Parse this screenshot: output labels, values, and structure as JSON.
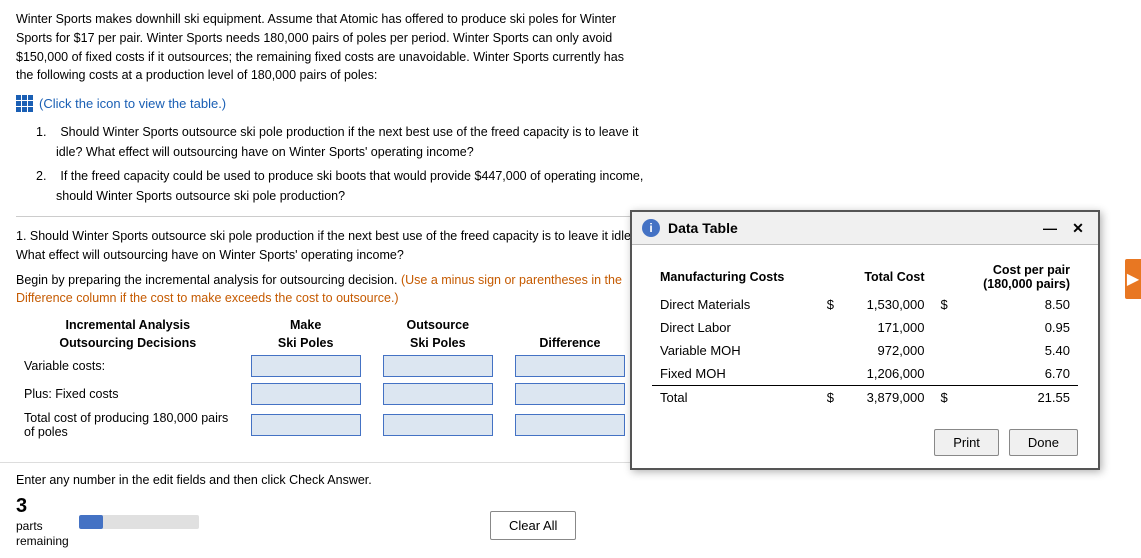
{
  "problem": {
    "text": "Winter Sports makes downhill ski equipment. Assume that Atomic has offered to produce ski poles for Winter Sports for $17 per pair. Winter Sports needs 180,000 pairs of poles per period. Winter Sports can only avoid $150,000 of fixed costs if it outsources; the remaining fixed costs are unavoidable. Winter Sports currently has the following costs at a production level of 180,000 pairs of poles:",
    "click_icon_text": "(Click the icon to view the table.)"
  },
  "questions": [
    {
      "number": "1.",
      "text": "Should Winter Sports outsource ski pole production if the next best use of the freed capacity is to leave it idle? What effect will outsourcing have on Winter Sports' operating income?"
    },
    {
      "number": "2.",
      "text": "If the freed capacity could be used to produce ski boots that would provide $447,000 of operating income, should Winter Sports outsource ski pole production?"
    }
  ],
  "question1_heading": "1. Should Winter Sports outsource ski pole production if the next best use of the freed capacity is to leave it idle? What effect will outsourcing have on Winter Sports' operating income?",
  "begin_text": "Begin by preparing the incremental analysis for outsourcing decision.",
  "orange_note": "(Use a minus sign or parentheses in the Difference column if the cost to make exceeds the cost to outsource.)",
  "table": {
    "col1": "Incremental Analysis",
    "col2_top": "Make",
    "col3_top": "Outsource",
    "col1_sub": "Outsourcing Decisions",
    "col2_sub": "Ski Poles",
    "col3_sub": "Ski Poles",
    "col4_sub": "Difference",
    "rows": [
      {
        "label": "Variable costs:",
        "make": "",
        "outsource": "",
        "diff": ""
      },
      {
        "label": "Plus: Fixed costs",
        "make": "",
        "outsource": "",
        "diff": ""
      },
      {
        "label": "Total cost of producing 180,000 pairs of poles",
        "make": "",
        "outsource": "",
        "diff": ""
      }
    ]
  },
  "bottom": {
    "enter_text": "Enter any number in the edit fields and then click Check Answer.",
    "parts_number": "3",
    "parts_label": "parts",
    "parts_sub": "remaining",
    "clear_all": "Clear All",
    "progress_pct": 20
  },
  "data_table_popup": {
    "title": "Data Table",
    "headers": {
      "col1": "Manufacturing Costs",
      "col2": "Total Cost",
      "col3_top": "Cost per pair",
      "col3_bot": "(180,000 pairs)"
    },
    "rows": [
      {
        "name": "Direct Materials",
        "dollar1": "$",
        "total": "1,530,000",
        "dollar2": "$",
        "per_pair": "8.50"
      },
      {
        "name": "Direct Labor",
        "dollar1": "",
        "total": "171,000",
        "dollar2": "",
        "per_pair": "0.95"
      },
      {
        "name": "Variable MOH",
        "dollar1": "",
        "total": "972,000",
        "dollar2": "",
        "per_pair": "5.40"
      },
      {
        "name": "Fixed MOH",
        "dollar1": "",
        "total": "1,206,000",
        "dollar2": "",
        "per_pair": "6.70"
      },
      {
        "name": "Total",
        "dollar1": "$",
        "total": "3,879,000",
        "dollar2": "$",
        "per_pair": "21.55",
        "is_total": true
      }
    ],
    "print_btn": "Print",
    "done_btn": "Done"
  }
}
